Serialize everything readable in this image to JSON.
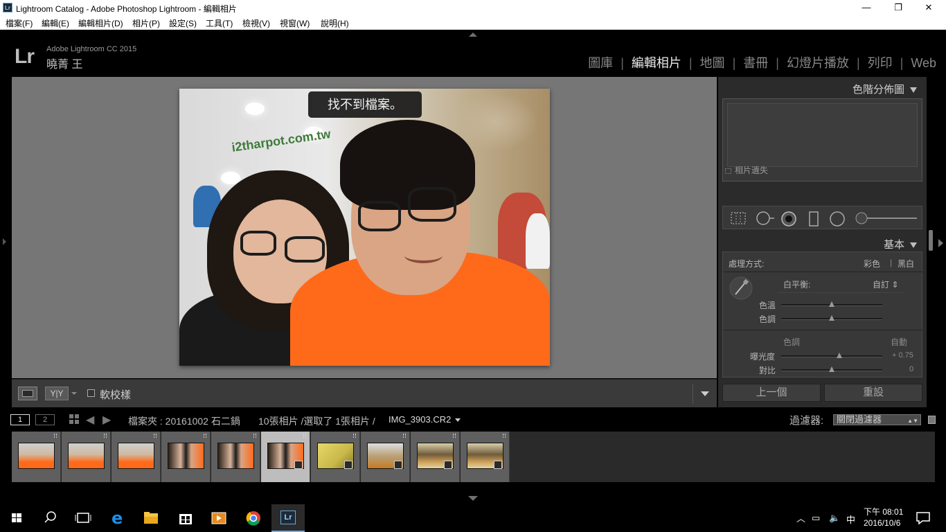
{
  "window": {
    "title": "Lightroom Catalog - Adobe Photoshop Lightroom - 編輯相片",
    "app_icon_label": "Lr",
    "minimize": "—",
    "restore": "❐",
    "close": "✕"
  },
  "menu": [
    "檔案(F)",
    "編輯(E)",
    "編輯相片(D)",
    "相片(P)",
    "設定(S)",
    "工具(T)",
    "檢視(V)",
    "視窗(W)",
    "說明(H)"
  ],
  "identity": {
    "logo": "Lr",
    "product": "Adobe Lightroom CC 2015",
    "user": "曉菁 王"
  },
  "modules": [
    {
      "label": "圖庫",
      "active": false
    },
    {
      "label": "編輯相片",
      "active": true
    },
    {
      "label": "地圖",
      "active": false
    },
    {
      "label": "書冊",
      "active": false
    },
    {
      "label": "幻燈片播放",
      "active": false
    },
    {
      "label": "列印",
      "active": false
    },
    {
      "label": "Web",
      "active": false
    }
  ],
  "photo": {
    "toast": "找不到檔案。",
    "sign_text": "i2tharpot.com.tw"
  },
  "toolbar": {
    "yy_label": "Y|Y",
    "soft_proof_label": "軟校樣",
    "soft_proof_checked": false
  },
  "right_panel": {
    "histogram_title": "色階分佈圖",
    "photo_missing": "相片遺失",
    "basic_title": "基本",
    "treatment_label": "處理方式:",
    "treatment_color": "彩色",
    "treatment_bw": "黑白",
    "treatment_sep": "|",
    "wb_label": "白平衡:",
    "wb_value": "自訂 ⇕",
    "temp_label": "色溫",
    "tint_label": "色調",
    "tone_label": "色調",
    "tone_auto": "自動",
    "exposure_label": "曝光度",
    "exposure_value": "+ 0.75",
    "contrast_label": "對比",
    "contrast_value": "0",
    "prev_button": "上一個",
    "reset_button": "重設"
  },
  "filmstrip_header": {
    "screen1": "1",
    "screen2": "2",
    "source": "檔案夾 : 20161002 石二鍋",
    "count": "10張相片 /選取了 1張相片 /",
    "filename": "IMG_3903.CR2",
    "filter_label": "過濾器:",
    "filter_value": "關閉過濾器",
    "filter_arrows": "▲▼"
  },
  "filmstrip": [
    {
      "kind": "man",
      "selected": false,
      "edited": false
    },
    {
      "kind": "man",
      "selected": false,
      "edited": false
    },
    {
      "kind": "man",
      "selected": false,
      "edited": false
    },
    {
      "kind": "couple",
      "selected": false,
      "edited": false
    },
    {
      "kind": "couple",
      "selected": false,
      "edited": false
    },
    {
      "kind": "couple",
      "selected": true,
      "edited": true
    },
    {
      "kind": "menu",
      "selected": false,
      "edited": true
    },
    {
      "kind": "drink",
      "selected": false,
      "edited": true
    },
    {
      "kind": "food",
      "selected": false,
      "edited": true
    },
    {
      "kind": "food",
      "selected": false,
      "edited": true
    }
  ],
  "taskbar": {
    "ime": "中",
    "time": "下午 08:01",
    "date": "2016/10/6",
    "lr_label": "Lr"
  },
  "colors": {
    "orange_shirt": "#ff6a1a",
    "panel_bg": "#2b2b2b",
    "work_bg": "#767676"
  }
}
